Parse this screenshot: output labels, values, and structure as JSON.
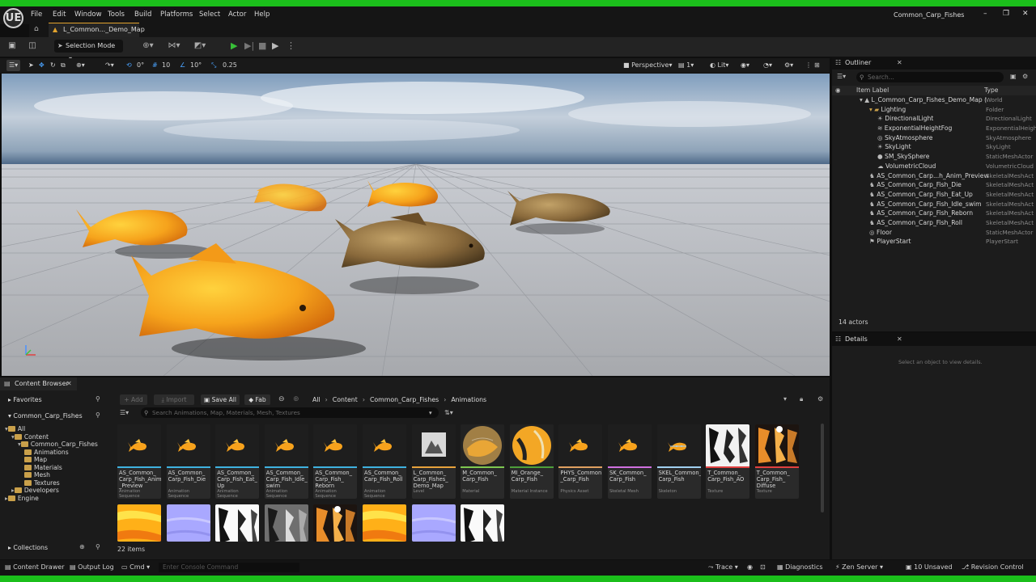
{
  "app": {
    "title": "Common_Carp_Fishes",
    "logo": "UE",
    "map_tab": "L_Common..._Demo_Map"
  },
  "menu": [
    "File",
    "Edit",
    "Window",
    "Tools",
    "Build",
    "Platforms",
    "Select",
    "Actor",
    "Help"
  ],
  "window_controls": {
    "minimize": "–",
    "restore": "❐",
    "close": "✕"
  },
  "toolbar": {
    "selection_mode": "Selection Mode"
  },
  "viewport_toolbar": {
    "rotate_snap": "0°",
    "grid_snap": "10",
    "angle_snap": "10°",
    "scale_snap": "0.25",
    "perspective": "Perspective",
    "camera_speed": "1",
    "lit": "Lit"
  },
  "outliner": {
    "title": "Outliner",
    "search_placeholder": "Search...",
    "col_label": "Item Label",
    "col_type": "Type",
    "rows": [
      {
        "label": "L_Common_Carp_Fishes_Demo_Map (",
        "type": "World",
        "indent": 0
      },
      {
        "label": "Lighting",
        "type": "Folder",
        "indent": 1
      },
      {
        "label": "DirectionalLight",
        "type": "DirectionalLight",
        "indent": 2
      },
      {
        "label": "ExponentialHeightFog",
        "type": "ExponentialHeigh",
        "indent": 2
      },
      {
        "label": "SkyAtmosphere",
        "type": "SkyAtmosphere",
        "indent": 2
      },
      {
        "label": "SkyLight",
        "type": "SkyLight",
        "indent": 2
      },
      {
        "label": "SM_SkySphere",
        "type": "StaticMeshActor",
        "indent": 2
      },
      {
        "label": "VolumetricCloud",
        "type": "VolumetricCloud",
        "indent": 2
      },
      {
        "label": "AS_Common_Carp...h_Anim_Preview",
        "type": "SkeletalMeshAct",
        "indent": 1
      },
      {
        "label": "AS_Common_Carp_Fish_Die",
        "type": "SkeletalMeshAct",
        "indent": 1
      },
      {
        "label": "AS_Common_Carp_Fish_Eat_Up",
        "type": "SkeletalMeshAct",
        "indent": 1
      },
      {
        "label": "AS_Common_Carp_Fish_Idle_swim",
        "type": "SkeletalMeshAct",
        "indent": 1
      },
      {
        "label": "AS_Common_Carp_Fish_Reborn",
        "type": "SkeletalMeshAct",
        "indent": 1
      },
      {
        "label": "AS_Common_Carp_Fish_Roll",
        "type": "SkeletalMeshAct",
        "indent": 1
      },
      {
        "label": "Floor",
        "type": "StaticMeshActor",
        "indent": 1
      },
      {
        "label": "PlayerStart",
        "type": "PlayerStart",
        "indent": 1
      }
    ],
    "count": "14 actors"
  },
  "details": {
    "title": "Details",
    "empty_text": "Select an object to view details."
  },
  "content_browser": {
    "title": "Content Browser",
    "add": "Add",
    "import": "Import",
    "save_all": "Save All",
    "fab": "Fab",
    "breadcrumb": [
      "All",
      "Content",
      "Common_Carp_Fishes",
      "Animations"
    ],
    "search_placeholder": "Search Animations, Map, Materials, Mesh, Textures",
    "favorites": "Favorites",
    "project": "Common_Carp_Fishes",
    "collections": "Collections",
    "tree": [
      {
        "label": "All",
        "indent": 0,
        "sel": true
      },
      {
        "label": "Content",
        "indent": 1,
        "sel": true
      },
      {
        "label": "Common_Carp_Fishes",
        "indent": 2,
        "sel": true
      },
      {
        "label": "Animations",
        "indent": 3,
        "sel": true
      },
      {
        "label": "Map",
        "indent": 3,
        "sel": true
      },
      {
        "label": "Materials",
        "indent": 3,
        "sel": true
      },
      {
        "label": "Mesh",
        "indent": 3,
        "sel": true
      },
      {
        "label": "Textures",
        "indent": 3,
        "sel": true
      },
      {
        "label": "Developers",
        "indent": 1,
        "sel": false
      },
      {
        "label": "Engine",
        "indent": 0,
        "sel": false
      }
    ],
    "assets": [
      {
        "name": "AS_Common_ Carp_Fish_Anim _Preview",
        "type": "Animation Sequence",
        "kind": "fish",
        "color": "#3fb2e0"
      },
      {
        "name": "AS_Common_ Carp_Fish_Die",
        "type": "Animation Sequence",
        "kind": "fish",
        "color": "#3fb2e0"
      },
      {
        "name": "AS_Common_ Carp_Fish_Eat_ Up",
        "type": "Animation Sequence",
        "kind": "fish",
        "color": "#3fb2e0"
      },
      {
        "name": "AS_Common_ Carp_Fish_Idle_ swim",
        "type": "Animation Sequence",
        "kind": "fish",
        "color": "#3fb2e0"
      },
      {
        "name": "AS_Common_ Carp_Fish_ Reborn",
        "type": "Animation Sequence",
        "kind": "fish",
        "color": "#3fb2e0"
      },
      {
        "name": "AS_Common_ Carp_Fish_Roll",
        "type": "Animation Sequence",
        "kind": "fish",
        "color": "#3fb2e0"
      },
      {
        "name": "L_Common_ Carp_Fishes_ Demo_Map",
        "type": "Level",
        "kind": "level",
        "color": "#e8a23c"
      },
      {
        "name": "M_Common_ Carp_Fish",
        "type": "Material",
        "kind": "sphere",
        "color": "#7ec850"
      },
      {
        "name": "MI_Orange_ Carp_Fish",
        "type": "Material Instance",
        "kind": "sphere2",
        "color": "#4d9e3a"
      },
      {
        "name": "PHYS_Common _Carp_Fish",
        "type": "Physics Asset",
        "kind": "fish",
        "color": "#e0a060"
      },
      {
        "name": "SK_Common_ Carp_Fish",
        "type": "Skeletal Mesh",
        "kind": "fish",
        "color": "#d070e0"
      },
      {
        "name": "SKEL_Common_ Carp_Fish",
        "type": "Skeleton",
        "kind": "fishbone",
        "color": "#a0d0f0"
      },
      {
        "name": "T_Common_ Carp_Fish_AO",
        "type": "Texture",
        "kind": "tex-ao",
        "color": "#e04040"
      },
      {
        "name": "T_Common_ Carp_Fish_ Diffuse",
        "type": "Texture",
        "kind": "tex-diff",
        "color": "#e04040"
      }
    ],
    "row2": [
      "tex-yellow",
      "tex-normal",
      "tex-bw",
      "tex-gray",
      "tex-diff",
      "tex-yellow",
      "tex-normal",
      "tex-bw"
    ],
    "count": "22 items"
  },
  "statusbar": {
    "content_drawer": "Content Drawer",
    "output_log": "Output Log",
    "cmd": "Cmd",
    "console_placeholder": "Enter Console Command",
    "trace": "Trace",
    "diagnostics": "Diagnostics",
    "zen": "Zen Server",
    "unsaved": "10 Unsaved",
    "revision": "Revision Control"
  },
  "colors": {
    "accent": "#e2a32d",
    "selection": "#26384d",
    "status_green": "#1bbf1b"
  }
}
